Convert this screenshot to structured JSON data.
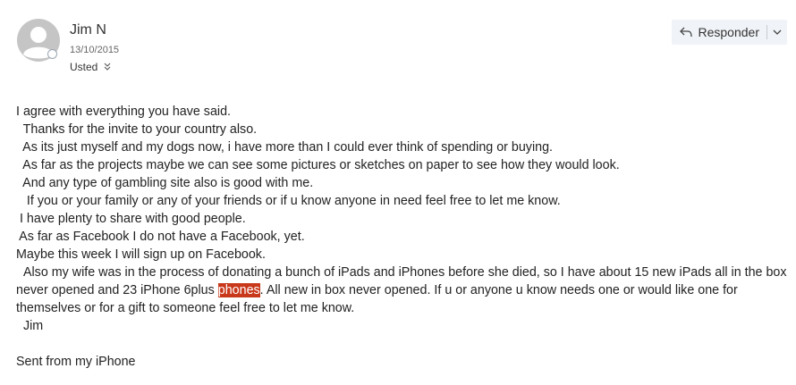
{
  "sender": {
    "name": "Jim N",
    "date": "13/10/2015",
    "recipient": "Usted"
  },
  "actions": {
    "reply_label": "Responder"
  },
  "message": {
    "lines": [
      "I agree with everything you have said.",
      "  Thanks for the invite to your country also.",
      "  As its just myself and my dogs now, i have more than I could ever think of spending or buying.",
      "  As far as the projects maybe we can see some pictures or sketches on paper to see how they would look.",
      "  And any type of gambling site also is good with me.",
      "   If you or your family or any of your friends or if u know anyone in need feel free to let me know.",
      " I have plenty to share with good people.",
      " As far as Facebook I do not have a Facebook, yet.",
      "Maybe this week I will sign up on Facebook."
    ],
    "long_para_before": "  Also my wife was in the process of donating a bunch of iPads and iPhones before she died, so I have about 15 new iPads all in the box never opened and 23 iPhone 6plus ",
    "highlight_word": "phones",
    "long_para_after": ". All new in box never opened. If u or anyone u know needs one or would like one for themselves or for a gift to someone feel free to let me know.",
    "sign_off": "  Jim",
    "signature": "Sent from my iPhone"
  },
  "colors": {
    "highlight": "#c8381b",
    "reply_bg": "#f0f3f7"
  }
}
